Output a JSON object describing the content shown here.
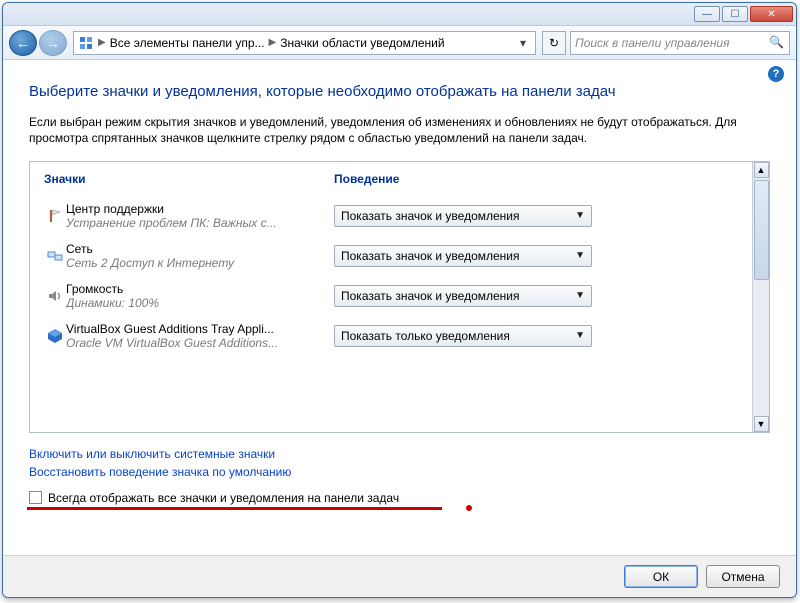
{
  "titlebar": {},
  "nav": {
    "breadcrumb1": "Все элементы панели упр...",
    "breadcrumb2": "Значки области уведомлений",
    "search_placeholder": "Поиск в панели управления"
  },
  "page": {
    "title": "Выберите значки и уведомления, которые необходимо отображать на панели задач",
    "description": "Если выбран режим скрытия значков и уведомлений, уведомления об изменениях и обновлениях не будут отображаться. Для просмотра спрятанных значков щелкните стрелку рядом с областью уведомлений на панели задач."
  },
  "columns": {
    "c1": "Значки",
    "c2": "Поведение"
  },
  "items": [
    {
      "icon": "flag",
      "title": "Центр поддержки",
      "sub": "Устранение проблем ПК: Важных с...",
      "behavior": "Показать значок и уведомления"
    },
    {
      "icon": "net",
      "title": "Сеть",
      "sub": "Сеть  2 Доступ к Интернету",
      "behavior": "Показать значок и уведомления"
    },
    {
      "icon": "vol",
      "title": "Громкость",
      "sub": "Динамики: 100%",
      "behavior": "Показать значок и уведомления"
    },
    {
      "icon": "vbox",
      "title": "VirtualBox Guest Additions Tray Appli...",
      "sub": "Oracle VM VirtualBox Guest Additions...",
      "behavior": "Показать только уведомления"
    }
  ],
  "links": {
    "l1": "Включить или выключить системные значки",
    "l2": "Восстановить поведение значка по умолчанию"
  },
  "checkbox": {
    "label": "Всегда отображать все значки и уведомления на панели задач"
  },
  "footer": {
    "ok": "ОК",
    "cancel": "Отмена"
  }
}
